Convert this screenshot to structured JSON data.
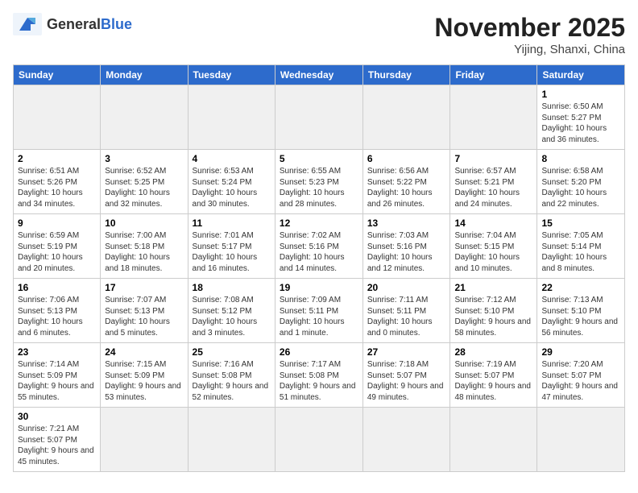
{
  "header": {
    "logo_general": "General",
    "logo_blue": "Blue",
    "month": "November 2025",
    "location": "Yijing, Shanxi, China"
  },
  "weekdays": [
    "Sunday",
    "Monday",
    "Tuesday",
    "Wednesday",
    "Thursday",
    "Friday",
    "Saturday"
  ],
  "weeks": [
    [
      {
        "day": "",
        "info": ""
      },
      {
        "day": "",
        "info": ""
      },
      {
        "day": "",
        "info": ""
      },
      {
        "day": "",
        "info": ""
      },
      {
        "day": "",
        "info": ""
      },
      {
        "day": "",
        "info": ""
      },
      {
        "day": "1",
        "info": "Sunrise: 6:50 AM\nSunset: 5:27 PM\nDaylight: 10 hours and 36 minutes."
      }
    ],
    [
      {
        "day": "2",
        "info": "Sunrise: 6:51 AM\nSunset: 5:26 PM\nDaylight: 10 hours and 34 minutes."
      },
      {
        "day": "3",
        "info": "Sunrise: 6:52 AM\nSunset: 5:25 PM\nDaylight: 10 hours and 32 minutes."
      },
      {
        "day": "4",
        "info": "Sunrise: 6:53 AM\nSunset: 5:24 PM\nDaylight: 10 hours and 30 minutes."
      },
      {
        "day": "5",
        "info": "Sunrise: 6:55 AM\nSunset: 5:23 PM\nDaylight: 10 hours and 28 minutes."
      },
      {
        "day": "6",
        "info": "Sunrise: 6:56 AM\nSunset: 5:22 PM\nDaylight: 10 hours and 26 minutes."
      },
      {
        "day": "7",
        "info": "Sunrise: 6:57 AM\nSunset: 5:21 PM\nDaylight: 10 hours and 24 minutes."
      },
      {
        "day": "8",
        "info": "Sunrise: 6:58 AM\nSunset: 5:20 PM\nDaylight: 10 hours and 22 minutes."
      }
    ],
    [
      {
        "day": "9",
        "info": "Sunrise: 6:59 AM\nSunset: 5:19 PM\nDaylight: 10 hours and 20 minutes."
      },
      {
        "day": "10",
        "info": "Sunrise: 7:00 AM\nSunset: 5:18 PM\nDaylight: 10 hours and 18 minutes."
      },
      {
        "day": "11",
        "info": "Sunrise: 7:01 AM\nSunset: 5:17 PM\nDaylight: 10 hours and 16 minutes."
      },
      {
        "day": "12",
        "info": "Sunrise: 7:02 AM\nSunset: 5:16 PM\nDaylight: 10 hours and 14 minutes."
      },
      {
        "day": "13",
        "info": "Sunrise: 7:03 AM\nSunset: 5:16 PM\nDaylight: 10 hours and 12 minutes."
      },
      {
        "day": "14",
        "info": "Sunrise: 7:04 AM\nSunset: 5:15 PM\nDaylight: 10 hours and 10 minutes."
      },
      {
        "day": "15",
        "info": "Sunrise: 7:05 AM\nSunset: 5:14 PM\nDaylight: 10 hours and 8 minutes."
      }
    ],
    [
      {
        "day": "16",
        "info": "Sunrise: 7:06 AM\nSunset: 5:13 PM\nDaylight: 10 hours and 6 minutes."
      },
      {
        "day": "17",
        "info": "Sunrise: 7:07 AM\nSunset: 5:13 PM\nDaylight: 10 hours and 5 minutes."
      },
      {
        "day": "18",
        "info": "Sunrise: 7:08 AM\nSunset: 5:12 PM\nDaylight: 10 hours and 3 minutes."
      },
      {
        "day": "19",
        "info": "Sunrise: 7:09 AM\nSunset: 5:11 PM\nDaylight: 10 hours and 1 minute."
      },
      {
        "day": "20",
        "info": "Sunrise: 7:11 AM\nSunset: 5:11 PM\nDaylight: 10 hours and 0 minutes."
      },
      {
        "day": "21",
        "info": "Sunrise: 7:12 AM\nSunset: 5:10 PM\nDaylight: 9 hours and 58 minutes."
      },
      {
        "day": "22",
        "info": "Sunrise: 7:13 AM\nSunset: 5:10 PM\nDaylight: 9 hours and 56 minutes."
      }
    ],
    [
      {
        "day": "23",
        "info": "Sunrise: 7:14 AM\nSunset: 5:09 PM\nDaylight: 9 hours and 55 minutes."
      },
      {
        "day": "24",
        "info": "Sunrise: 7:15 AM\nSunset: 5:09 PM\nDaylight: 9 hours and 53 minutes."
      },
      {
        "day": "25",
        "info": "Sunrise: 7:16 AM\nSunset: 5:08 PM\nDaylight: 9 hours and 52 minutes."
      },
      {
        "day": "26",
        "info": "Sunrise: 7:17 AM\nSunset: 5:08 PM\nDaylight: 9 hours and 51 minutes."
      },
      {
        "day": "27",
        "info": "Sunrise: 7:18 AM\nSunset: 5:07 PM\nDaylight: 9 hours and 49 minutes."
      },
      {
        "day": "28",
        "info": "Sunrise: 7:19 AM\nSunset: 5:07 PM\nDaylight: 9 hours and 48 minutes."
      },
      {
        "day": "29",
        "info": "Sunrise: 7:20 AM\nSunset: 5:07 PM\nDaylight: 9 hours and 47 minutes."
      }
    ],
    [
      {
        "day": "30",
        "info": "Sunrise: 7:21 AM\nSunset: 5:07 PM\nDaylight: 9 hours and 45 minutes."
      },
      {
        "day": "",
        "info": ""
      },
      {
        "day": "",
        "info": ""
      },
      {
        "day": "",
        "info": ""
      },
      {
        "day": "",
        "info": ""
      },
      {
        "day": "",
        "info": ""
      },
      {
        "day": "",
        "info": ""
      }
    ]
  ]
}
